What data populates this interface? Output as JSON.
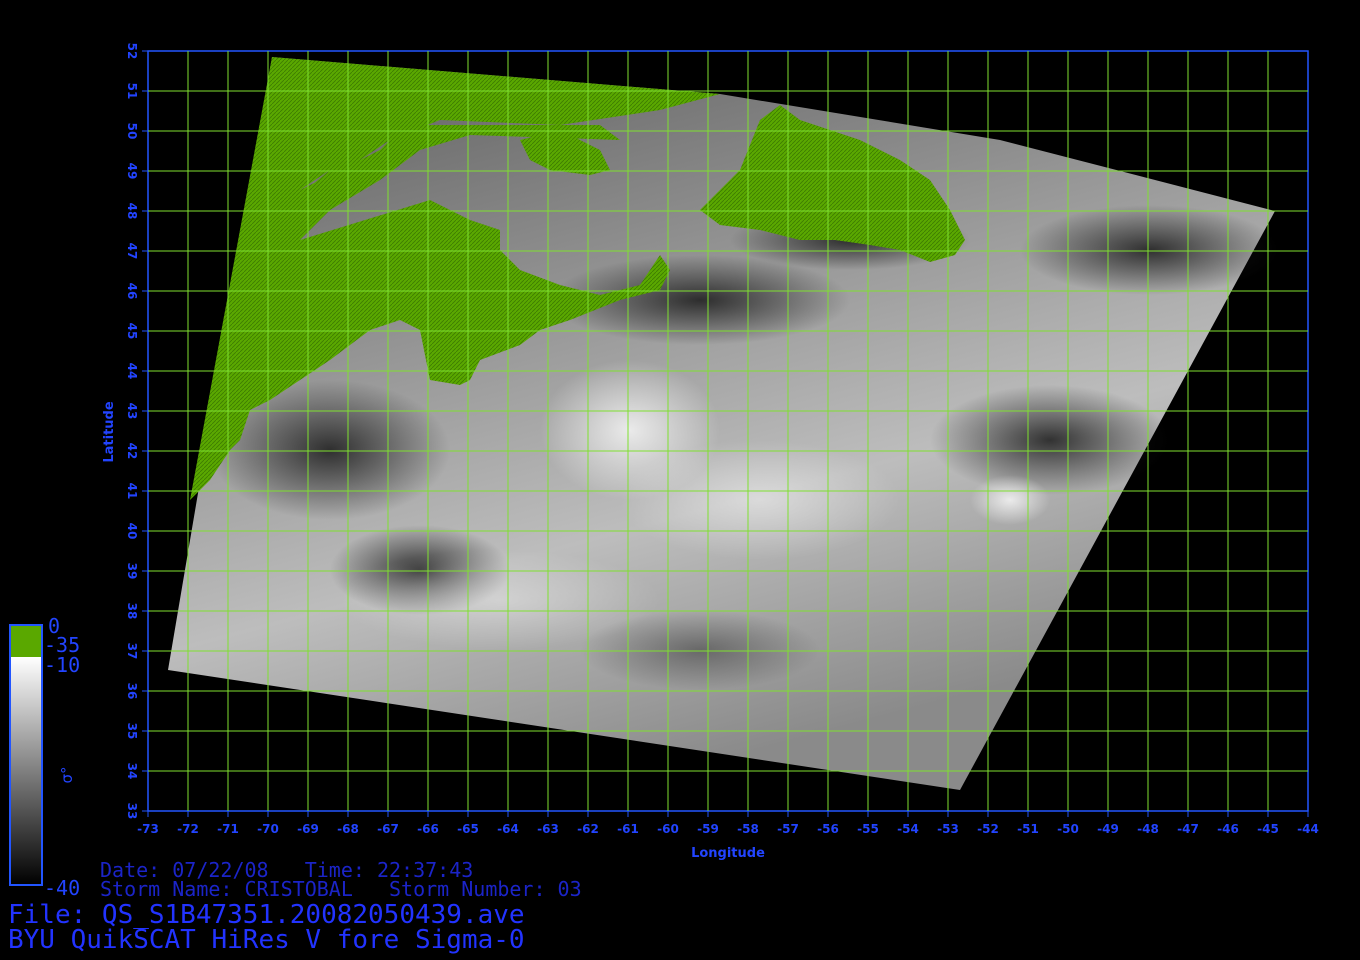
{
  "map": {
    "x_axis_label": "Longitude",
    "y_axis_label": "Latitude",
    "longitude_ticks": [
      "-73",
      "-72",
      "-71",
      "-70",
      "-69",
      "-68",
      "-67",
      "-66",
      "-65",
      "-64",
      "-63",
      "-62",
      "-61",
      "-60",
      "-59",
      "-58",
      "-57",
      "-56",
      "-55",
      "-54",
      "-53",
      "-52",
      "-51",
      "-50",
      "-49",
      "-48",
      "-47",
      "-46",
      "-45",
      "-44"
    ],
    "latitude_ticks": [
      "33",
      "34",
      "35",
      "36",
      "37",
      "38",
      "39",
      "40",
      "41",
      "42",
      "43",
      "44",
      "45",
      "46",
      "47",
      "48",
      "49",
      "50",
      "51",
      "52"
    ],
    "lon_range": [
      -73,
      -44
    ],
    "lat_range": [
      33,
      52
    ],
    "grid_color": "#7fe030",
    "frame_color": "#2255ff",
    "land_color": "#5aa800"
  },
  "colorbar": {
    "top_label": "0",
    "land_label": "-35",
    "mid_label": "-10",
    "bottom_label": "-40",
    "symbol": "σ°"
  },
  "info": {
    "date_line": "Date: 07/22/08   Time: 22:37:43",
    "storm_line": "Storm Name: CRISTOBAL   Storm Number: 03",
    "file_line": "File: QS_S1B47351.20082050439.ave",
    "product_line": "BYU QuikSCAT HiRes V fore Sigma-0"
  }
}
